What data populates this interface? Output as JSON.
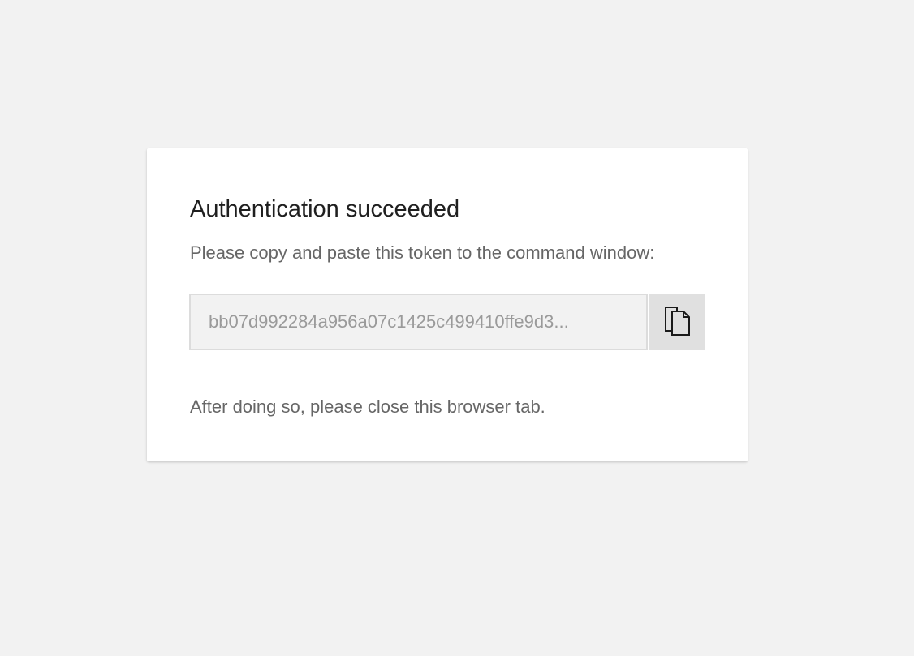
{
  "card": {
    "title": "Authentication succeeded",
    "subtitle": "Please copy and paste this token to the command window:",
    "token_value": "bb07d992284a956a07c1425c499410ffe9d3...",
    "copy_icon": "copy-icon",
    "footer": "After doing so, please close this browser tab."
  },
  "colors": {
    "background": "#f2f2f2",
    "card": "#ffffff",
    "title_text": "#1f1f1f",
    "body_text": "#666666",
    "token_text": "#9a9a9a",
    "copy_button_bg": "#e0e0e0"
  }
}
